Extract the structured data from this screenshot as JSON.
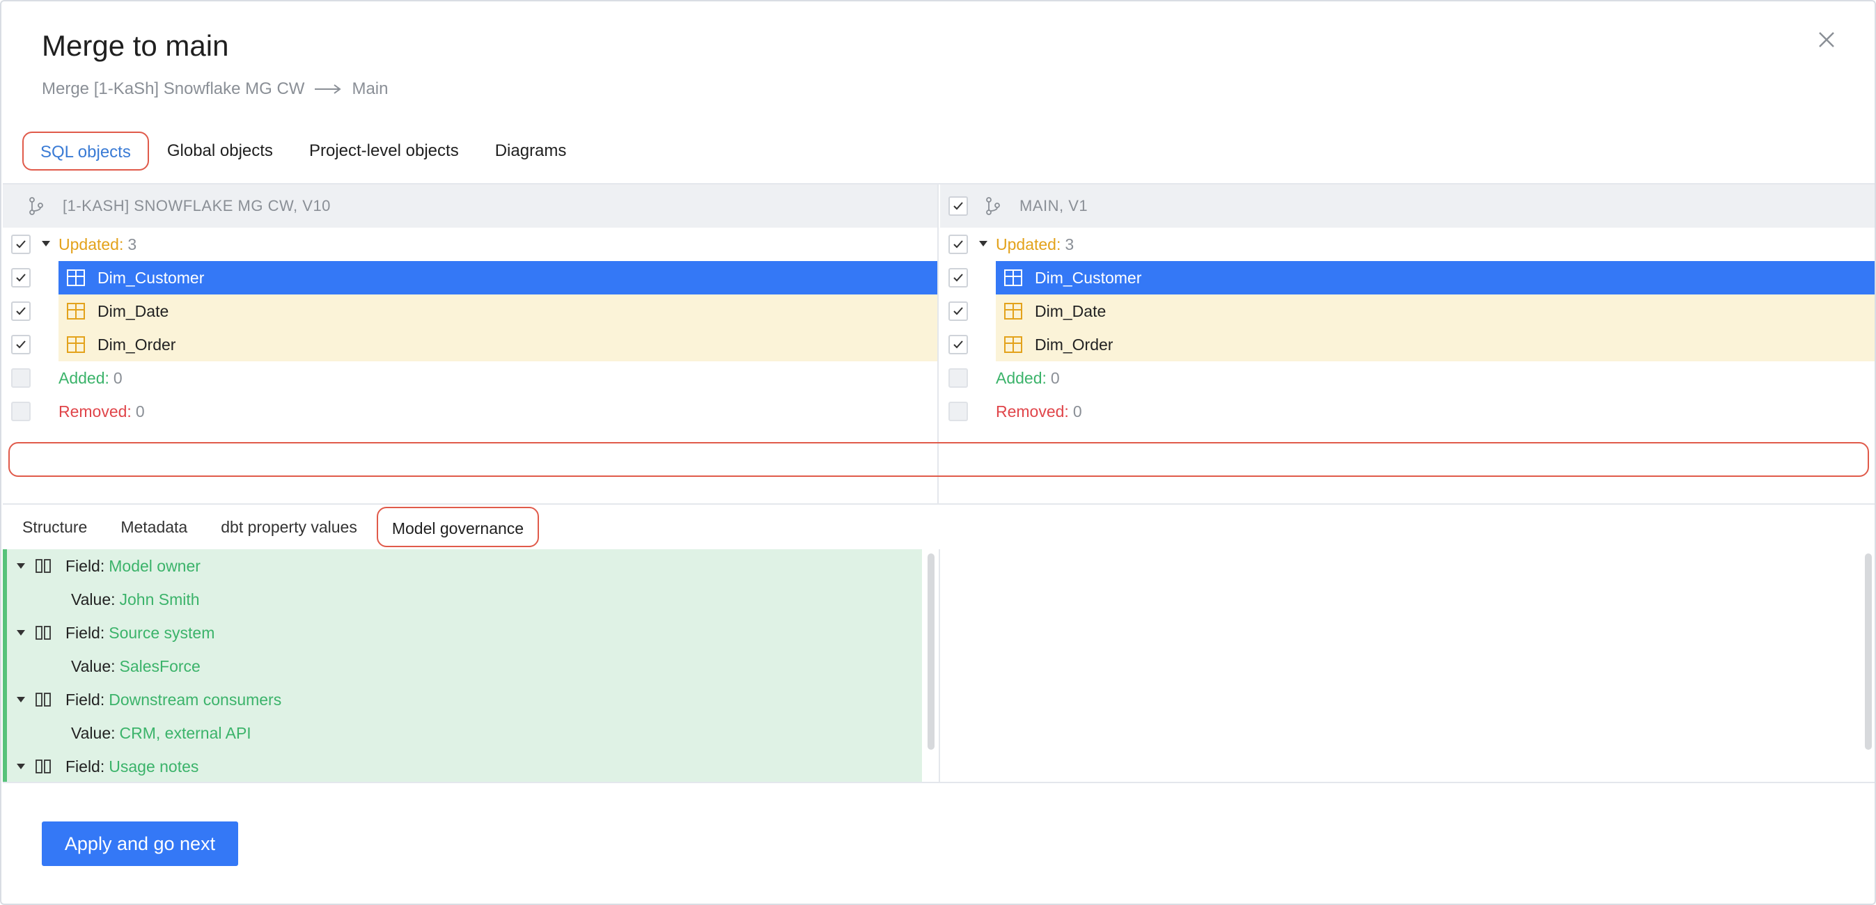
{
  "dialog": {
    "title": "Merge to main",
    "subtitle_from": "Merge [1-KaSh] Snowflake MG CW",
    "subtitle_to": "Main"
  },
  "tabs": [
    "SQL objects",
    "Global objects",
    "Project-level objects",
    "Diagrams"
  ],
  "active_tab": "SQL objects",
  "left_pane": {
    "header": "[1-KASH] SNOWFLAKE MG CW, V10",
    "groups": {
      "updated_label": "Updated:",
      "updated_count": "3",
      "added_label": "Added:",
      "added_count": "0",
      "removed_label": "Removed:",
      "removed_count": "0"
    },
    "items": [
      "Dim_Customer",
      "Dim_Date",
      "Dim_Order"
    ]
  },
  "right_pane": {
    "header": "MAIN, V1",
    "groups": {
      "updated_label": "Updated:",
      "updated_count": "3",
      "added_label": "Added:",
      "added_count": "0",
      "removed_label": "Removed:",
      "removed_count": "0"
    },
    "items": [
      "Dim_Customer",
      "Dim_Date",
      "Dim_Order"
    ]
  },
  "selected_item": "Dim_Customer",
  "subtabs": [
    "Structure",
    "Metadata",
    "dbt property values",
    "Model governance"
  ],
  "active_subtab": "Model governance",
  "detail": {
    "field_label": "Field:",
    "value_label": "Value:",
    "fields": [
      {
        "name": "Model owner",
        "value": "John Smith"
      },
      {
        "name": "Source system",
        "value": "SalesForce"
      },
      {
        "name": "Downstream consumers",
        "value": "CRM, external API"
      },
      {
        "name": "Usage notes"
      }
    ]
  },
  "buttons": {
    "apply": "Apply and go next"
  },
  "icons": {
    "close": "close-icon",
    "arrow": "arrow-right-icon",
    "branch": "git-branch-icon",
    "table": "table-icon",
    "column": "column-icon",
    "check": "check-icon"
  },
  "colors": {
    "accent": "#3478f6",
    "updated": "#e3a21b",
    "added": "#3bb36a",
    "removed": "#e0454a",
    "highlight_outline": "#e05a4a",
    "updated_row_bg": "#fbf3d8",
    "added_detail_bg": "#dff2e5"
  }
}
